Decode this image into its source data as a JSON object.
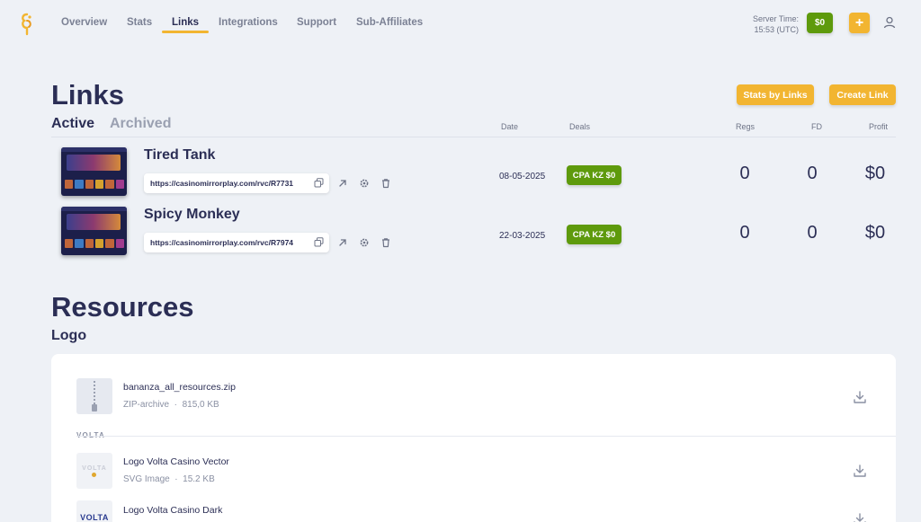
{
  "nav": {
    "items": [
      "Overview",
      "Stats",
      "Links",
      "Integrations",
      "Support",
      "Sub-Affiliates"
    ],
    "active": "Links",
    "server_time_label": "Server Time:",
    "server_time_value": "15:53 (UTC)",
    "balance": "$0",
    "plus": "+"
  },
  "links": {
    "title": "Links",
    "tabs": [
      "Active",
      "Archived"
    ],
    "buttons": {
      "stats_by_links": "Stats by Links",
      "create_link": "Create Link"
    },
    "columns": {
      "date": "Date",
      "deals": "Deals",
      "regs": "Regs",
      "fd": "FD",
      "profit": "Profit"
    },
    "rows": [
      {
        "name": "Tired Tank",
        "url": "https://casinomirrorplay.com/rvc/R7731",
        "date": "08-05-2025",
        "deal": "CPA KZ $0",
        "regs": "0",
        "fd": "0",
        "profit": "$0"
      },
      {
        "name": "Spicy Monkey",
        "url": "https://casinomirrorplay.com/rvc/R7974",
        "date": "22-03-2025",
        "deal": "CPA KZ $0",
        "regs": "0",
        "fd": "0",
        "profit": "$0"
      }
    ]
  },
  "resources": {
    "title": "Resources",
    "subtitle": "Logo",
    "archive": {
      "name": "bananza_all_resources.zip",
      "type": "ZIP-archive",
      "size": "815,0 KB"
    },
    "group_label": "VOLTA",
    "files": [
      {
        "name": "Logo Volta Casino Vector",
        "type": "SVG Image",
        "size": "15.2 KB",
        "thumb_text": "VOLTA"
      },
      {
        "name": "Logo Volta Casino Dark",
        "type": "",
        "size": "",
        "thumb_text": "VOLTA"
      }
    ]
  },
  "icons": {
    "logo": "brand-logo-icon",
    "user": "user-icon",
    "copy": "copy-icon",
    "open": "arrow-up-right-icon",
    "settings": "gear-icon",
    "delete": "trash-icon",
    "download": "download-icon",
    "zip": "zip-file-icon"
  },
  "colors": {
    "accent_yellow": "#f2b531",
    "green": "#5e9a0c",
    "text_dark": "#2b2e55",
    "background": "#eef1f6"
  }
}
